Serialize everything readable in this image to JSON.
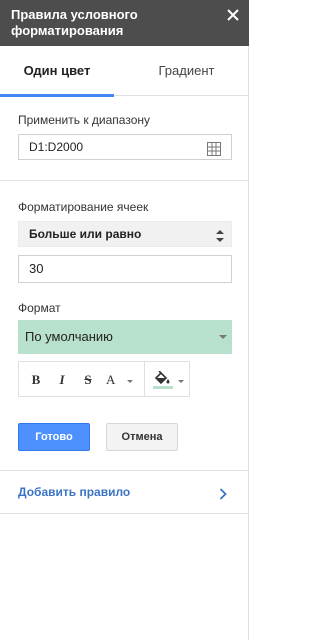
{
  "header": {
    "title": "Правила условного форматирования"
  },
  "tabs": [
    {
      "label": "Один цвет",
      "active": true
    },
    {
      "label": "Градиент",
      "active": false
    }
  ],
  "range": {
    "label": "Применить к диапазону",
    "value": "D1:D2000"
  },
  "condition": {
    "label": "Форматирование ячеек",
    "selected": "Больше или равно",
    "value": "30"
  },
  "format": {
    "label": "Формат",
    "preset": "По умолчанию",
    "preset_color": "#b7e1cd",
    "bold_label": "B",
    "italic_label": "I",
    "strike_label": "S",
    "text_color_label": "A"
  },
  "actions": {
    "done": "Готово",
    "cancel": "Отмена"
  },
  "add_rule": {
    "label": "Добавить правило"
  },
  "colors": {
    "header_bg": "#4d4d4d",
    "accent": "#4285f4",
    "done_bg": "#4d90fe",
    "link": "#3b73c5"
  }
}
